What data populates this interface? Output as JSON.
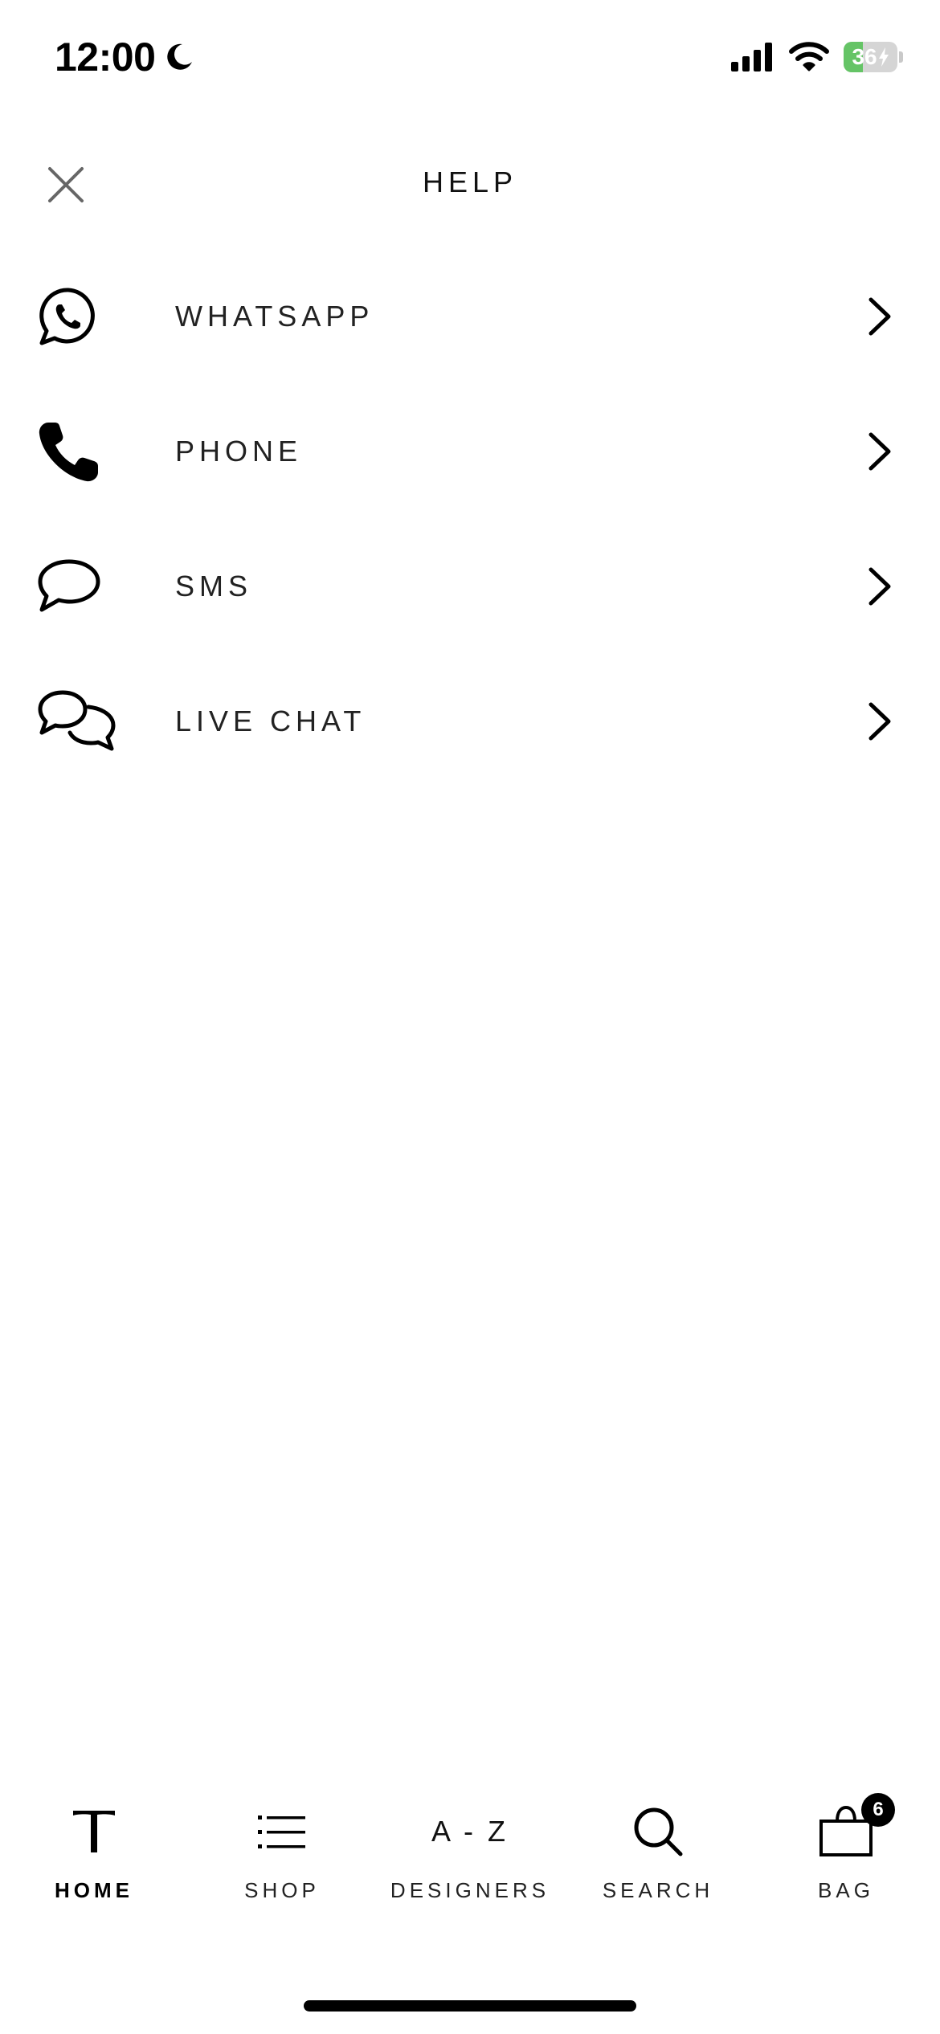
{
  "status_bar": {
    "time": "12:00",
    "battery_level": "36",
    "battery_fraction": 0.36,
    "battery_color": "#65c466",
    "icons": [
      "moon-icon",
      "cellular-signal-icon",
      "wifi-icon",
      "battery-charging-icon"
    ]
  },
  "header": {
    "title": "HELP",
    "close_icon": "close-icon"
  },
  "help_items": [
    {
      "label": "WHATSAPP",
      "icon": "whatsapp-icon"
    },
    {
      "label": "PHONE",
      "icon": "phone-icon"
    },
    {
      "label": "SMS",
      "icon": "speech-bubble-icon"
    },
    {
      "label": "LIVE CHAT",
      "icon": "chat-bubbles-icon"
    }
  ],
  "tab_bar": {
    "tabs": [
      {
        "label": "HOME",
        "icon": "home-t-logo-icon",
        "active": true
      },
      {
        "label": "SHOP",
        "icon": "list-icon",
        "active": false
      },
      {
        "label": "DESIGNERS",
        "icon_text": "A - Z",
        "active": false
      },
      {
        "label": "SEARCH",
        "icon": "search-icon",
        "active": false
      },
      {
        "label": "BAG",
        "icon": "shopping-bag-icon",
        "active": false,
        "badge": "6"
      }
    ]
  },
  "colors": {
    "text": "#111111",
    "background": "#ffffff",
    "badge": "#000000"
  }
}
